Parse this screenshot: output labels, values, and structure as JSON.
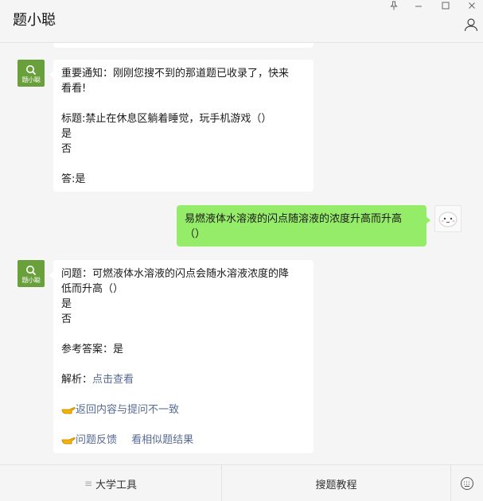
{
  "window": {
    "title": "题小聪",
    "controls": {
      "pin": "pin-icon",
      "minimize": "minimize-icon",
      "maximize": "maximize-icon",
      "close": "close-icon"
    },
    "profile_icon": "person-icon"
  },
  "bot": {
    "avatar_label": "题小聪"
  },
  "messages": {
    "m1": {
      "line1": "重要通知：刚刚您搜不到的那道题已收录了，快来",
      "line2": "看看!",
      "title_line": "标题:禁止在休息区躺着睡觉，玩手机游戏（）",
      "opt_yes": "是",
      "opt_no": "否",
      "answer": "答:是"
    },
    "m2": {
      "line1": "易燃液体水溶液的闪点随溶液的浓度升高而升高",
      "line2": "（）"
    },
    "m3": {
      "line1": "问题：可燃液体水溶液的闪点会随水溶液浓度的降",
      "line2": "低而升高（）",
      "opt_yes": "是",
      "opt_no": "否",
      "ref_answer": "参考答案：是",
      "analysis_label": "解析：",
      "analysis_link": "点击查看",
      "mismatch_link": "返回内容与提问不一致",
      "feedback_link": "问题反馈",
      "similar_link": "看相似题结果"
    }
  },
  "bottom_menu": {
    "tab1": "大学工具",
    "tab2": "搜题教程"
  },
  "colors": {
    "bot_avatar": "#6aa03c",
    "user_bubble": "#95ec69",
    "link": "#576b95"
  }
}
